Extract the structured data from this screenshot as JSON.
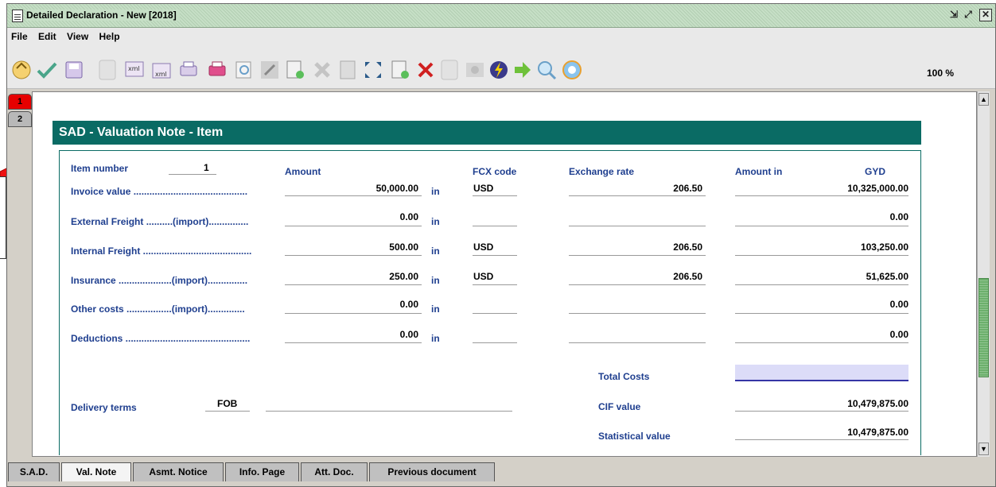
{
  "window": {
    "title": "Detailed Declaration - New [2018]"
  },
  "menu": {
    "items": [
      "File",
      "Edit",
      "View",
      "Help"
    ]
  },
  "toolbar": {
    "zoom": "100 %",
    "icons": [
      "open-icon",
      "check-icon",
      "save-icon",
      "blank-icon",
      "xml-export-icon",
      "xml-import-icon",
      "print-preview-icon",
      "print-icon",
      "find-icon",
      "edit-icon",
      "new-item-icon",
      "delete-icon",
      "document-icon",
      "expand-icon",
      "add-item-icon",
      "remove-icon",
      "blank2-icon",
      "view-icon",
      "lightning-icon",
      "forward-icon",
      "zoom-icon",
      "help-icon"
    ]
  },
  "page_tabs": {
    "tab1": "1",
    "tab2": "2"
  },
  "section": {
    "title": "SAD - Valuation Note - Item"
  },
  "headers": {
    "item_number_label": "Item number",
    "item_number_value": "1",
    "amount": "Amount",
    "fcx_code": "FCX code",
    "exchange_rate": "Exchange rate",
    "amount_in": "Amount in",
    "currency": "GYD"
  },
  "rows": [
    {
      "label": "Invoice value ...........................................",
      "amount": "50,000.00",
      "in": "in",
      "fcx": "USD",
      "rate": "206.50",
      "amount_gyd": "10,325,000.00"
    },
    {
      "label": "External Freight ..........(import)...............",
      "amount": "0.00",
      "in": "in",
      "fcx": "",
      "rate": "",
      "amount_gyd": "0.00"
    },
    {
      "label": "Internal Freight .........................................",
      "amount": "500.00",
      "in": "in",
      "fcx": "USD",
      "rate": "206.50",
      "amount_gyd": "103,250.00"
    },
    {
      "label": "Insurance ....................(import)...............",
      "amount": "250.00",
      "in": "in",
      "fcx": "USD",
      "rate": "206.50",
      "amount_gyd": "51,625.00"
    },
    {
      "label": "Other costs .................(import)..............",
      "amount": "0.00",
      "in": "in",
      "fcx": "",
      "rate": "",
      "amount_gyd": "0.00"
    },
    {
      "label": "Deductions ...............................................",
      "amount": "0.00",
      "in": "in",
      "fcx": "",
      "rate": "",
      "amount_gyd": "0.00"
    }
  ],
  "delivery": {
    "label": "Delivery terms",
    "value": "FOB",
    "place": ""
  },
  "totals": {
    "total_costs_label": "Total Costs",
    "total_costs_value": "",
    "cif_label": "CIF value",
    "cif_value": "10,479,875.00",
    "statistical_label": "Statistical value",
    "statistical_value": "10,479,875.00"
  },
  "bottom_tabs": [
    "S.A.D.",
    "Val. Note",
    "Asmt. Notice",
    "Info. Page",
    "Att. Doc.",
    "Previous document"
  ],
  "colors": {
    "header_bg": "#0a6b64",
    "label_blue": "#1f3f8f",
    "active_tab_red": "#e60000",
    "total_box": "#dcdcf8"
  }
}
